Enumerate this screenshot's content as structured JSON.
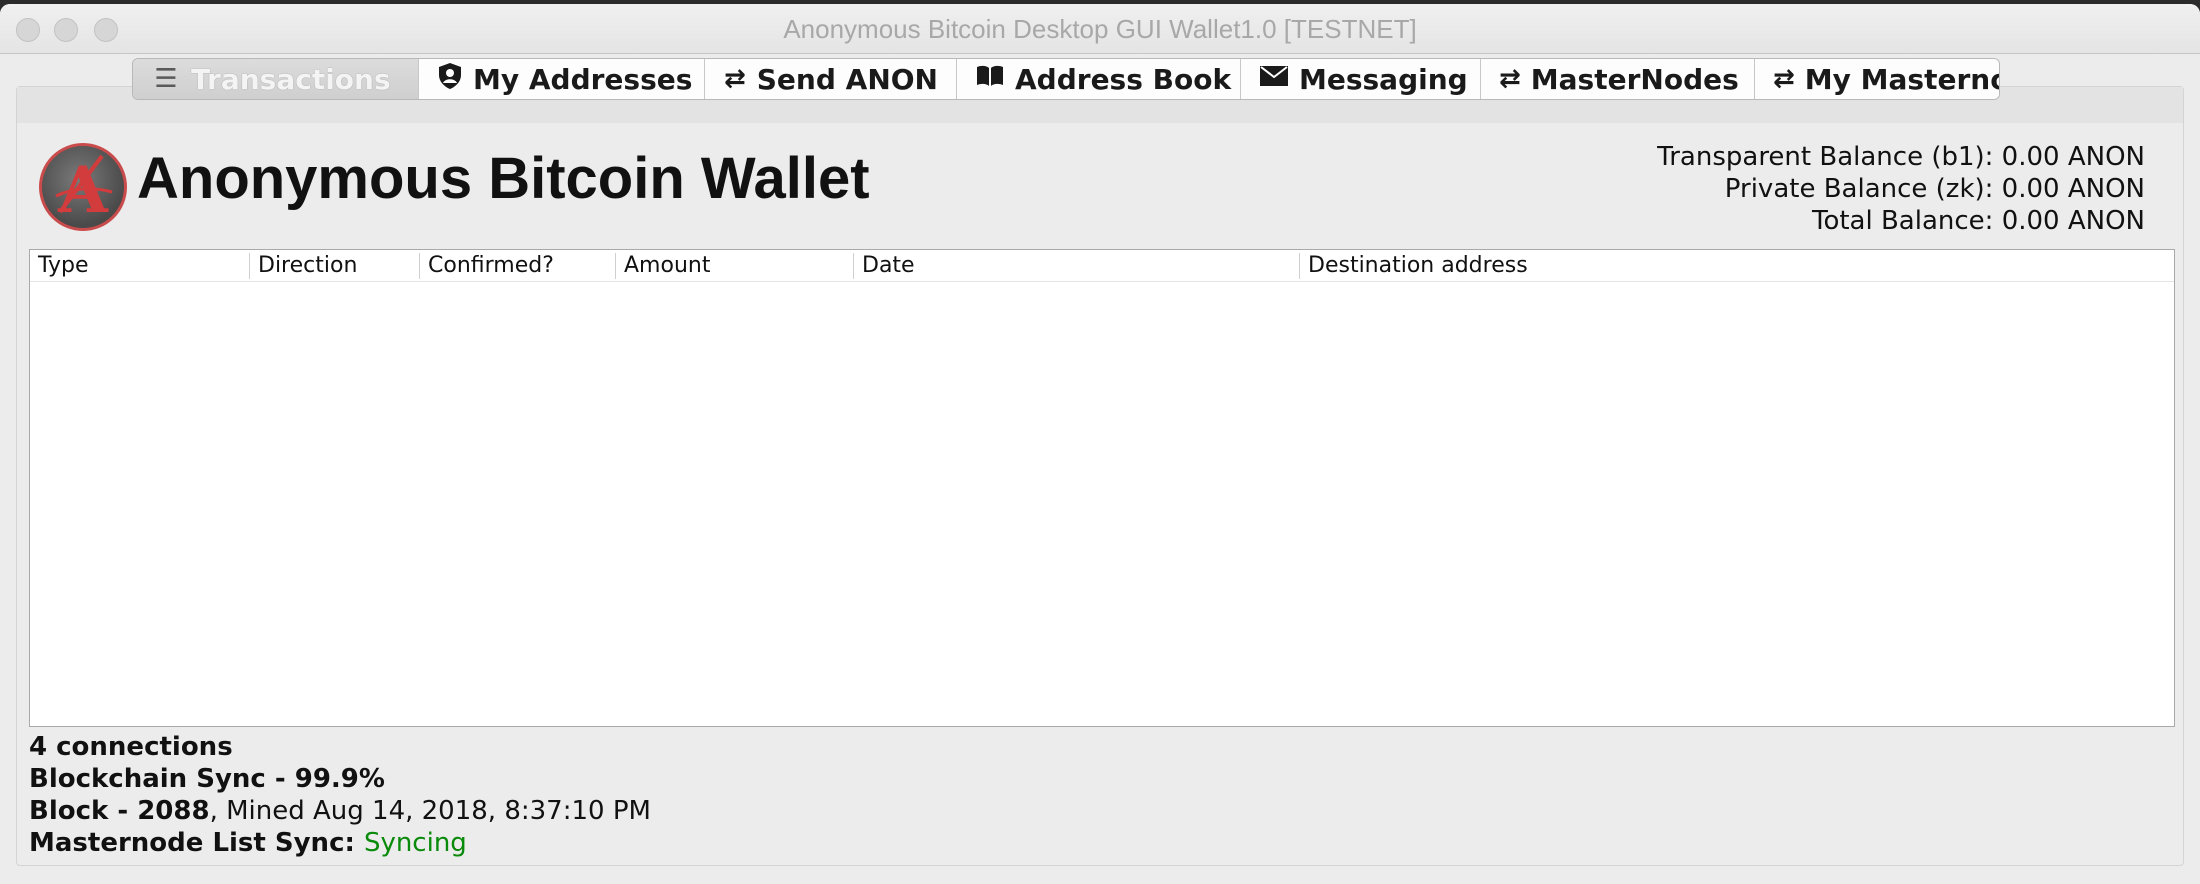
{
  "window": {
    "title": "Anonymous Bitcoin Desktop GUI Wallet1.0 [TESTNET]"
  },
  "tabs": [
    {
      "label": "Transactions",
      "icon": "list-icon"
    },
    {
      "label": "My Addresses",
      "icon": "shield-icon"
    },
    {
      "label": "Send ANON",
      "icon": "shuffle-icon"
    },
    {
      "label": "Address Book",
      "icon": "book-icon"
    },
    {
      "label": "Messaging",
      "icon": "envelope-icon"
    },
    {
      "label": "MasterNodes",
      "icon": "shuffle-icon"
    },
    {
      "label": "My Masternodes",
      "icon": "shuffle-icon"
    }
  ],
  "header": {
    "app_name": "Anonymous Bitcoin Wallet",
    "transparent_balance": "Transparent Balance (b1): 0.00 ANON",
    "private_balance": "Private Balance (zk): 0.00 ANON",
    "total_balance": "Total Balance: 0.00 ANON"
  },
  "table": {
    "columns": [
      "Type",
      "Direction",
      "Confirmed?",
      "Amount",
      "Date",
      "Destination address"
    ],
    "rows": []
  },
  "status": {
    "connections": "4 connections",
    "sync_label": "Blockchain Sync  - 99.9%",
    "block_label": "Block - 2088",
    "block_mined": ", Mined Aug 14, 2018, 8:37:10 PM",
    "mn_label": "Masternode List Sync: ",
    "mn_value": "Syncing"
  },
  "colors": {
    "status_green": "#0a8a0a",
    "logo_red": "#c94b4b"
  }
}
